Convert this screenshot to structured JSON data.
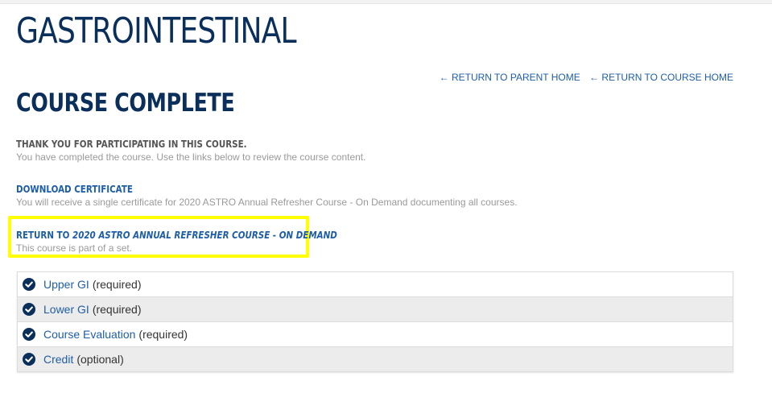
{
  "header": {
    "title": "GASTROINTESTINAL"
  },
  "nav": {
    "return_parent": "RETURN TO PARENT HOME",
    "return_course": "RETURN TO COURSE HOME",
    "arrow": "←"
  },
  "main": {
    "section_title": "COURSE COMPLETE",
    "thanks_heading": "THANK YOU FOR PARTICIPATING IN THIS COURSE.",
    "thanks_text": "You have completed the course. Use the links below to review the course content.",
    "download_heading": "DOWNLOAD CERTIFICATE",
    "download_text": "You will receive a single certificate for 2020 ASTRO Annual Refresher Course - On Demand documenting all courses.",
    "return_prefix": "RETURN TO ",
    "return_course_name": "2020 ASTRO ANNUAL REFRESHER COURSE - ON DEMAND",
    "return_text": "This course is part of a set."
  },
  "courses": [
    {
      "name": "Upper GI",
      "status": "(required)",
      "icon": "check-circle-icon"
    },
    {
      "name": "Lower GI",
      "status": "(required)",
      "icon": "check-circle-icon"
    },
    {
      "name": "Course Evaluation",
      "status": "(required)",
      "icon": "check-circle-icon"
    },
    {
      "name": "Credit",
      "status": "(optional)",
      "icon": "check-circle-icon"
    }
  ],
  "colors": {
    "title_navy": "#0b2f5b",
    "link_blue": "#1e5ea8",
    "highlight_yellow": "#ffff00",
    "check_navy": "#0b2f5b"
  }
}
